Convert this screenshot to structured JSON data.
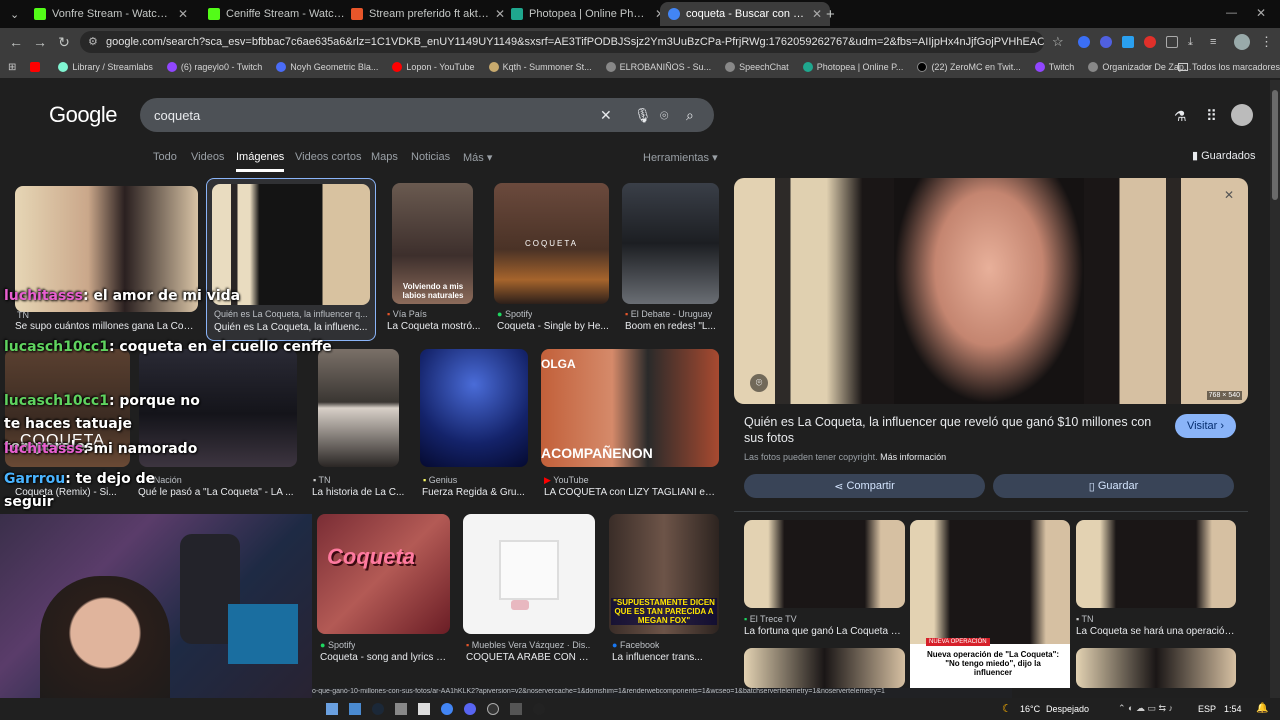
{
  "tabs": [
    {
      "title": "Vonfre Stream - Watch Live",
      "color": "#53fc18"
    },
    {
      "title": "Ceniffe Stream - Watch Live on",
      "color": "#53fc18"
    },
    {
      "title": "Stream preferido ft akta by mil",
      "color": "#e8562a"
    },
    {
      "title": "Photopea | Online Photo Editor",
      "color": "#1fa78e"
    },
    {
      "title": "coqueta - Buscar con Google",
      "color": "#4285f4"
    }
  ],
  "new_tab": "+",
  "url": "google.com/search?sca_esv=bfbbac7c6ae635a6&rlz=1C1VDKB_enUY1149UY1149&sxsrf=AE3TifPODBJSsjz2Ym3UuBzCPa-PfrjRWg:1762059262767&udm=2&fbs=AIIjpHx4nJjfGojPVHhEACUHPiMQ33KVMWSawhpRB5XP_...",
  "bookmarks": [
    {
      "label": "",
      "color": "#ff0000"
    },
    {
      "label": "Library / Streamlabs",
      "color": "#80f5d2"
    },
    {
      "label": "(6) rageylo0 - Twitch",
      "color": "#9146ff"
    },
    {
      "label": "Noyh Geometric Bla...",
      "color": "#4a6cf7"
    },
    {
      "label": "Lopon - YouTube",
      "color": "#ff0000"
    },
    {
      "label": "Kqth - Summoner St...",
      "color": "#c8aa6e"
    },
    {
      "label": "ELROBANIÑOS - Su...",
      "color": "#888888"
    },
    {
      "label": "SpeechChat",
      "color": "#888888"
    },
    {
      "label": "Photopea | Online P...",
      "color": "#1fa78e"
    },
    {
      "label": "(22) ZeroMC en Twit...",
      "color": "#000000"
    },
    {
      "label": "Twitch",
      "color": "#9146ff"
    },
    {
      "label": "Organizador De Zap...",
      "color": "#888888"
    }
  ],
  "all_bookmarks": "Todos los marcadores",
  "google": {
    "logo": "Google",
    "query": "coqueta",
    "nav": [
      "Todo",
      "Videos",
      "Imágenes",
      "Videos cortos",
      "Maps",
      "Noticias",
      "Más"
    ],
    "tools": "Herramientas",
    "saved": "Guardados"
  },
  "results_row1": [
    {
      "source": "TN",
      "caption": "Se supo cuántos millones gana La Coqu..."
    },
    {
      "source": "Quién es La Coqueta, la influencer q...",
      "caption": "Quién es La Coqueta, la influenc..."
    },
    {
      "source": "Vía País",
      "caption": "La Coqueta mostró..."
    },
    {
      "source": "Spotify",
      "caption": "Coqueta - Single by He..."
    },
    {
      "source": "El Debate - Uruguay",
      "caption": "Boom en redes! \"L..."
    }
  ],
  "thumb_overlay_text": "Volviendo a mis labios naturales",
  "thumb_coqueta_text": "COQUETA",
  "results_row2": [
    {
      "source": "",
      "caption": "Coqueta (Remix) - Si..."
    },
    {
      "source": "Nación",
      "caption": "Qué le pasó a \"La Coqueta\" - LA ..."
    },
    {
      "source": "TN",
      "caption": "La historia de La C..."
    },
    {
      "source": "Genius",
      "caption": "Fuerza Regida & Gru..."
    },
    {
      "source": "YouTube",
      "caption": "LA COQUETA con LIZY TAGLIANI en ..."
    }
  ],
  "row2_overlay": "ACOMPAÑENON",
  "row2_overlay2": "OLGA",
  "results_row3": [
    {
      "source": "Spotify",
      "caption": "Coqueta - song and lyrics b..."
    },
    {
      "source": "Muebles Vera Vázquez · Dis...",
      "caption": "COQUETA ÁRABE CON 5 ..."
    },
    {
      "source": "Facebook",
      "caption": "La influencer trans..."
    }
  ],
  "coqueta_logo": "Coqueta",
  "fb_overlay": "\"SUPUESTAMENTE DICEN QUE ES TAN PARECIDA A MEGAN FOX\"",
  "panel": {
    "dims": "768 × 540",
    "title": "Quién es La Coqueta, la influencer que reveló que ganó $10 millones con sus fotos",
    "visit": "Visitar",
    "copyright": "Las fotos pueden tener copyright.",
    "more_info": "Más información",
    "share": "Compartir",
    "save": "Guardar",
    "related": [
      {
        "source": "El Trece TV",
        "caption": "La fortuna que ganó La Coqueta e..."
      },
      {
        "source": "",
        "caption": ""
      },
      {
        "source": "TN",
        "caption": "La Coqueta se hará una operación..."
      }
    ],
    "news_tag": "NUEVA OPERACIÓN",
    "news_caption": "Nueva operación de \"La Coqueta\": \"No tengo miedo\", dijo la influencer"
  },
  "chat": [
    {
      "user": "luchitasss",
      "msg": ": el amor de mi vida"
    },
    {
      "user": "lucasch10cc1",
      "msg": ": coqueta en el cuello cenffe"
    },
    {
      "user": "lucasch10cc1",
      "msg": ": porque no te haces tatuaje temporales"
    },
    {
      "user": "luchitasss",
      "msg": ": mi namorado"
    },
    {
      "user": "Garrrou",
      "msg": ": te dejo de seguir"
    }
  ],
  "status_url": "o-que-ganó-10-millones-con-sus-fotos/ar-AA1hKLK2?apiversion=v2&noservercache=1&domshim=1&renderwebcomponents=1&wcseo=1&batchservertelemetry=1&noservertelemetry=1",
  "taskbar": {
    "weather": "16°C",
    "condition": "Despejado",
    "lang": "ESP",
    "time": "1:54"
  }
}
